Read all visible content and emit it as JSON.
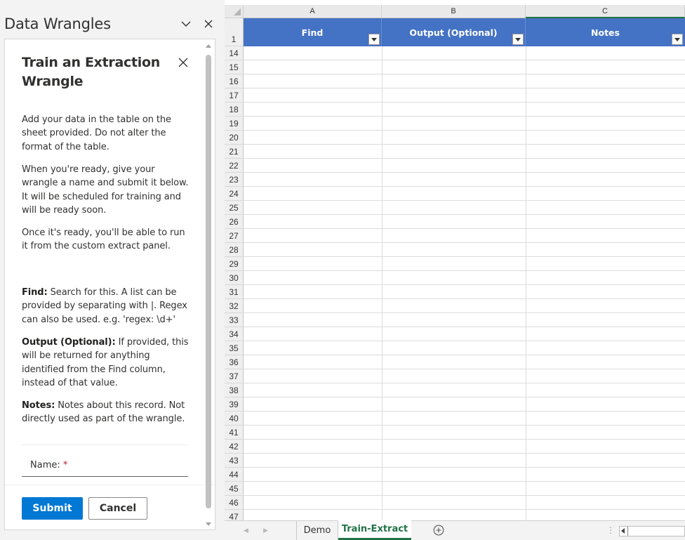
{
  "pane": {
    "title": "Data Wrangles",
    "card_title": "Train an Extraction Wrangle",
    "intro_1": "Add your data in the table on the sheet provided. Do not alter the format of the table.",
    "intro_2": "When you're ready, give your wrangle a name and submit it below. It will be scheduled for training and will be ready soon.",
    "intro_3": "Once it's ready, you'll be able to run it from the custom extract panel.",
    "find_term": "Find:",
    "find_desc": " Search for this. A list can be provided by separating with |. Regex can also be used. e.g. 'regex: \\d+'",
    "output_term": "Output (Optional):",
    "output_desc": " If provided, this will be returned for anything identified from the Find column, instead of that value.",
    "notes_term": "Notes:",
    "notes_desc": " Notes about this record. Not directly used as part of the wrangle.",
    "name_label": "Name:",
    "name_required_mark": "*",
    "name_value": "",
    "submit_label": "Submit",
    "cancel_label": "Cancel"
  },
  "sheet": {
    "columns": [
      "A",
      "B",
      "C"
    ],
    "table_headers": [
      "Find",
      "Output (Optional)",
      "Notes"
    ],
    "header_row_number": "1",
    "row_numbers": [
      "14",
      "15",
      "16",
      "17",
      "18",
      "19",
      "20",
      "21",
      "22",
      "23",
      "24",
      "25",
      "26",
      "27",
      "28",
      "29",
      "30",
      "31",
      "32",
      "33",
      "34",
      "35",
      "36",
      "37",
      "38",
      "39",
      "40",
      "41",
      "42",
      "43",
      "44",
      "45",
      "46",
      "47"
    ],
    "selected_column": "C",
    "table_header_color": "#4472c4"
  },
  "tabs": {
    "items": [
      "Demo",
      "Train-Extract"
    ],
    "active": "Train-Extract",
    "accent_color": "#217346"
  },
  "icons": {
    "pane_collapse": "chevron-down-icon",
    "pane_close": "close-icon",
    "card_close": "close-icon",
    "add_sheet": "plus-circle-icon"
  }
}
